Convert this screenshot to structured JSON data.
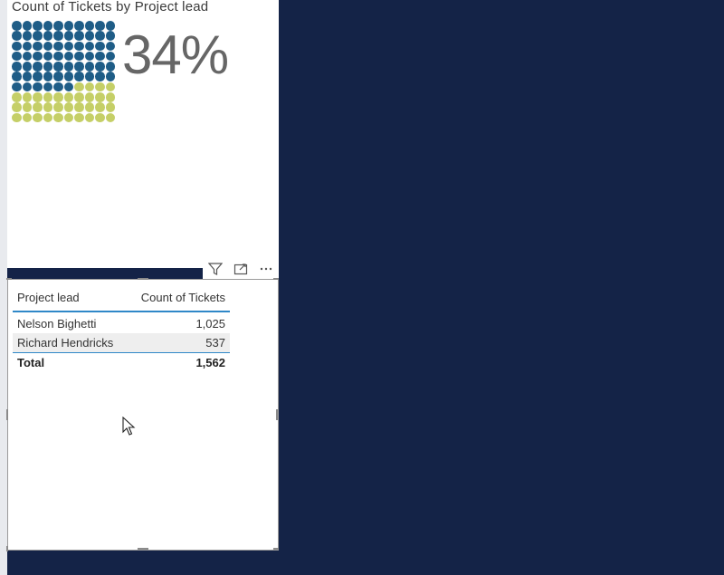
{
  "waffle": {
    "title": "Count of Tickets by Project lead",
    "kpi": "34%",
    "fraction": 0.66,
    "colors": {
      "primary": "#1f5d87",
      "secondary": "#c5cf67"
    },
    "total_dots": 100,
    "primary_dots": 66
  },
  "header_icons": [
    "filter-icon",
    "focus-mode-icon",
    "more-options-icon"
  ],
  "table": {
    "columns": [
      "Project lead",
      "Count of Tickets"
    ],
    "rows": [
      {
        "lead": "Nelson Bighetti",
        "count": "1,025"
      },
      {
        "lead": "Richard Hendricks",
        "count": "537"
      }
    ],
    "total": {
      "label": "Total",
      "count": "1,562"
    }
  },
  "colors": {
    "background": "#142347",
    "accent": "#2f88c8"
  }
}
